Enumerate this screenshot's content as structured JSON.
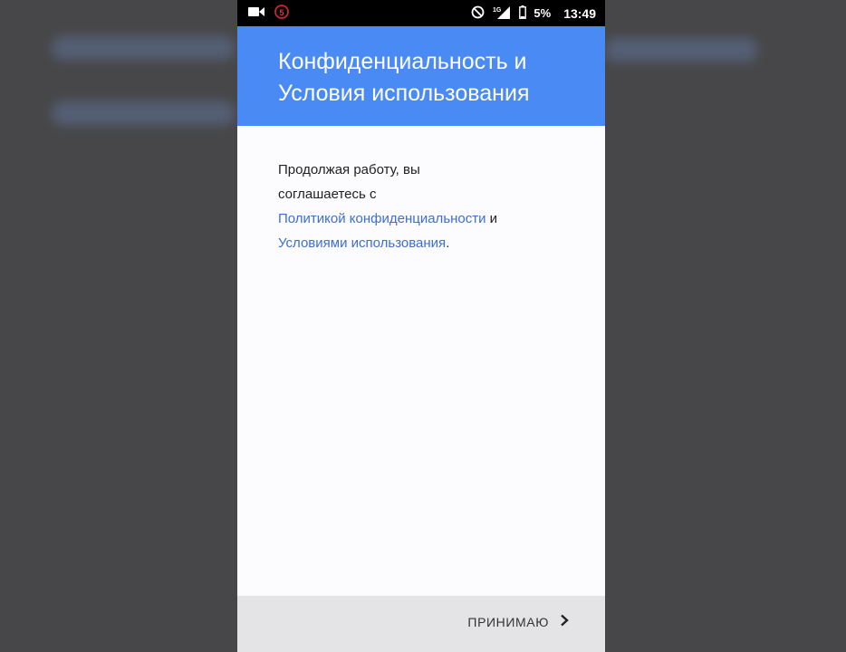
{
  "status_bar": {
    "battery_percent": "5%",
    "time": "13:49",
    "notification_badge": "5",
    "network_label": "1G",
    "icons": [
      "video-camera-icon",
      "notification-badge-icon",
      "do-not-disturb-icon",
      "signal-icon",
      "battery-icon"
    ]
  },
  "header": {
    "title": "Конфиденциальность и Условия использования"
  },
  "content": {
    "intro": "Продолжая работу, вы соглашаетесь с",
    "privacy_link": "Политикой конфиденциальности",
    "conjunction": " и",
    "terms_link": "Условиями использования",
    "period": "."
  },
  "footer": {
    "accept_label": "ПРИНИМАЮ"
  },
  "colors": {
    "header_blue": "#4a8af4",
    "link_blue": "#3c6fd1",
    "footer_gray": "#e4e3e5"
  }
}
